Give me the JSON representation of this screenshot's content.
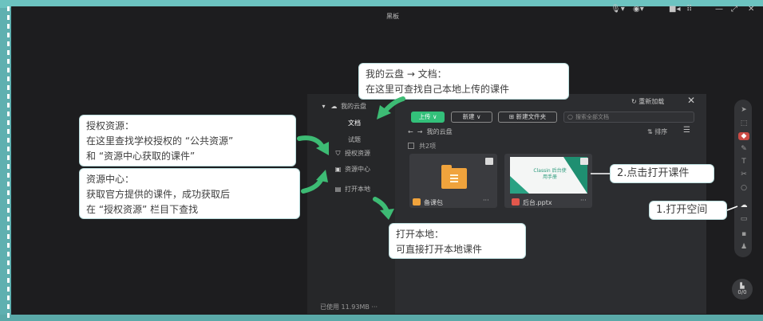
{
  "window": {
    "title": "黑板",
    "controls": [
      "mic-icon",
      "camera-icon",
      "record-icon",
      "grid-icon",
      "minimize-icon",
      "expand-icon",
      "close-icon"
    ]
  },
  "sidebar": {
    "items": [
      {
        "label": "我的云盘",
        "icon": "cloud-icon"
      },
      {
        "label": "文档",
        "icon": ""
      },
      {
        "label": "试题",
        "icon": ""
      },
      {
        "label": "授权资源",
        "icon": "shield-icon"
      },
      {
        "label": "资源中心",
        "icon": "store-icon"
      },
      {
        "label": "打开本地",
        "icon": "folder-open-icon"
      }
    ],
    "storage": "已使用 11.93MB ···"
  },
  "panel": {
    "reload": "重新加载",
    "buttons": {
      "upload": "上传 ∨",
      "new": "新建 ∨",
      "new_folder": "新建文件夹"
    },
    "search_placeholder": "搜索全部文档",
    "breadcrumb": "我的云盘",
    "sort": "排序",
    "count": "共2项",
    "files": [
      {
        "name": "备课包",
        "type": "folder"
      },
      {
        "name": "后台.pptx",
        "type": "pptx",
        "thumb_text": "Classin 后台使用手册"
      }
    ]
  },
  "callouts": {
    "cloud": {
      "line1": "我的云盘 → 文档：",
      "line2": "在这里可查找自己本地上传的课件"
    },
    "auth": {
      "line1": "授权资源：",
      "line2": "在这里查找学校授权的 “公共资源”",
      "line3": "和 “资源中心获取的课件”"
    },
    "resource": {
      "line1": "资源中心：",
      "line2": "获取官方提供的课件，成功获取后",
      "line3": "在 “授权资源” 栏目下查找"
    },
    "local": {
      "line1": "打开本地：",
      "line2": "可直接打开本地课件"
    },
    "open": "2.点击打开课件",
    "space": "1.打开空间"
  },
  "right_toolbar": {
    "tools": [
      "pointer-icon",
      "select-icon",
      "eraser-icon",
      "highlighter-icon",
      "text-icon",
      "scissors-icon",
      "shape-icon",
      "cloud-drive-icon",
      "toolbox-icon",
      "camera-tool-icon",
      "users-icon"
    ],
    "page": "0/0"
  },
  "colors": {
    "accent_green": "#33c07a",
    "arrow_green": "#3dbb74",
    "active_red": "#cc4b45",
    "folder_orange": "#f0a33c",
    "frame_teal": "#6cc3c0"
  }
}
